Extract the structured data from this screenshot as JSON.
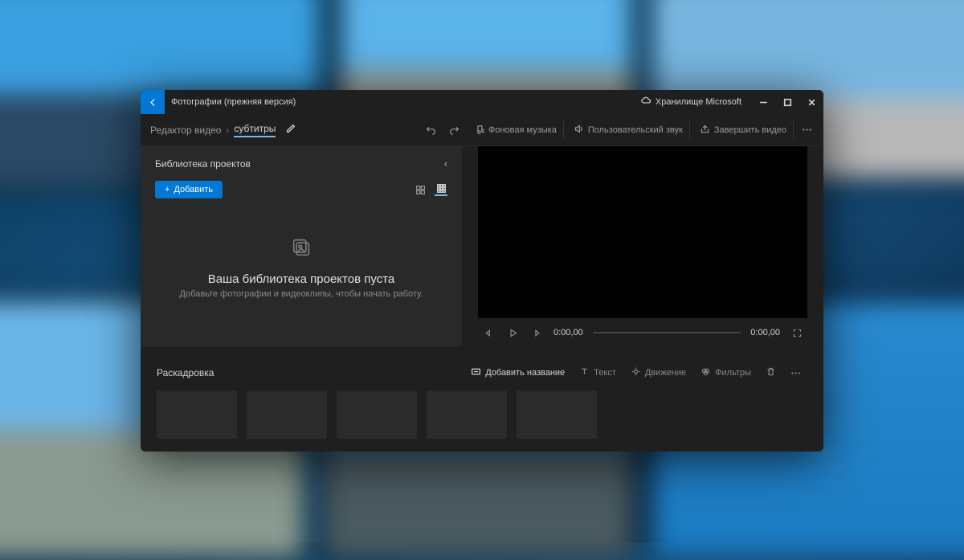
{
  "app": {
    "title": "Фотографии (прежняя версия)",
    "storage": "Хранилище Microsoft"
  },
  "breadcrumb": {
    "root": "Редактор видео",
    "current": "субтитры"
  },
  "toolbar": {
    "bg_music": "Фоновая музыка",
    "custom_audio": "Пользовательский звук",
    "finish": "Завершить видео"
  },
  "library": {
    "header": "Библиотека проектов",
    "add": "Добавить",
    "empty_title": "Ваша библиотека проектов пуста",
    "empty_sub": "Добавьте фотографии и видеоклипы, чтобы начать работу."
  },
  "playback": {
    "current": "0:00,00",
    "total": "0:00,00"
  },
  "storyboard": {
    "title": "Раскадровка",
    "add_title": "Добавить название",
    "text": "Текст",
    "motion": "Движение",
    "filters": "Фильтры"
  }
}
